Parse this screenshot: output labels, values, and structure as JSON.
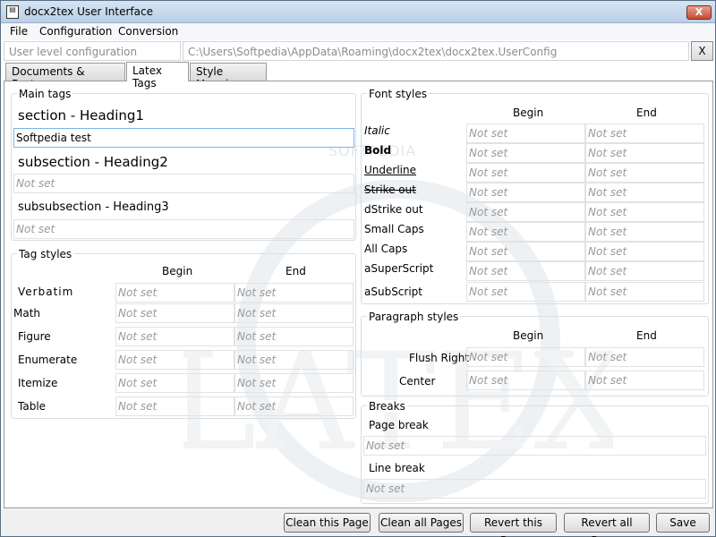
{
  "window": {
    "title": "docx2tex User Interface",
    "close_label": "X"
  },
  "menu": [
    "File",
    "Configuration",
    "Conversion"
  ],
  "config": {
    "label_placeholder": "User level configuration",
    "path": "C:\\Users\\Softpedia\\AppData\\Roaming\\docx2tex\\docx2tex.UserConfig",
    "close_label": "X"
  },
  "tabs": [
    "Documents & Features",
    "Latex Tags",
    "Style Mapping"
  ],
  "active_tab": "Latex Tags",
  "main_tags": {
    "title": "Main tags",
    "items": [
      {
        "label": "section - Heading1",
        "value": "Softpedia test"
      },
      {
        "label": "subsection - Heading2",
        "value": "Not set"
      },
      {
        "label": "subsubsection - Heading3",
        "value": "Not set"
      }
    ]
  },
  "tag_styles": {
    "title": "Tag styles",
    "begin_header": "Begin",
    "end_header": "End",
    "rows": [
      {
        "label": "Verbatim",
        "begin": "Not set",
        "end": "Not set"
      },
      {
        "label": "Math",
        "begin": "Not set",
        "end": "Not set"
      },
      {
        "label": "Figure",
        "begin": "Not set",
        "end": "Not set"
      },
      {
        "label": "Enumerate",
        "begin": "Not set",
        "end": "Not set"
      },
      {
        "label": "Itemize",
        "begin": "Not set",
        "end": "Not set"
      },
      {
        "label": "Table",
        "begin": "Not set",
        "end": "Not set"
      }
    ]
  },
  "font_styles": {
    "title": "Font styles",
    "begin_header": "Begin",
    "end_header": "End",
    "rows": [
      {
        "label": "Italic",
        "begin": "Not set",
        "end": "Not set"
      },
      {
        "label": "Bold",
        "begin": "Not set",
        "end": "Not set"
      },
      {
        "label": "Underline",
        "begin": "Not set",
        "end": "Not set"
      },
      {
        "label": "Strike out",
        "begin": "Not set",
        "end": "Not set"
      },
      {
        "label": "dStrike out",
        "begin": "Not set",
        "end": "Not set"
      },
      {
        "label": "Small Caps",
        "begin": "Not set",
        "end": "Not set"
      },
      {
        "label": "All Caps",
        "begin": "Not set",
        "end": "Not set"
      },
      {
        "label": "aSuperScript",
        "begin": "Not set",
        "end": "Not set"
      },
      {
        "label": "aSubScript",
        "begin": "Not set",
        "end": "Not set"
      }
    ]
  },
  "paragraph_styles": {
    "title": "Paragraph styles",
    "begin_header": "Begin",
    "end_header": "End",
    "rows": [
      {
        "label": "Flush Right",
        "begin": "Not set",
        "end": "Not set"
      },
      {
        "label": "Center",
        "begin": "Not set",
        "end": "Not set"
      }
    ]
  },
  "breaks": {
    "title": "Breaks",
    "items": [
      {
        "label": "Page break",
        "value": "Not set"
      },
      {
        "label": "Line break",
        "value": "Not set"
      }
    ]
  },
  "buttons": [
    "Clean this Page",
    "Clean all Pages",
    "Revert this Page",
    "Revert all Pages",
    "Save"
  ],
  "watermark": {
    "text": "SOFTPEDIA",
    "icon": "latex-watermark-logo"
  },
  "colors": {
    "titlebar": "#c6d8ec",
    "close_button": "#c74a32",
    "focus_border": "#7eb4ea"
  }
}
